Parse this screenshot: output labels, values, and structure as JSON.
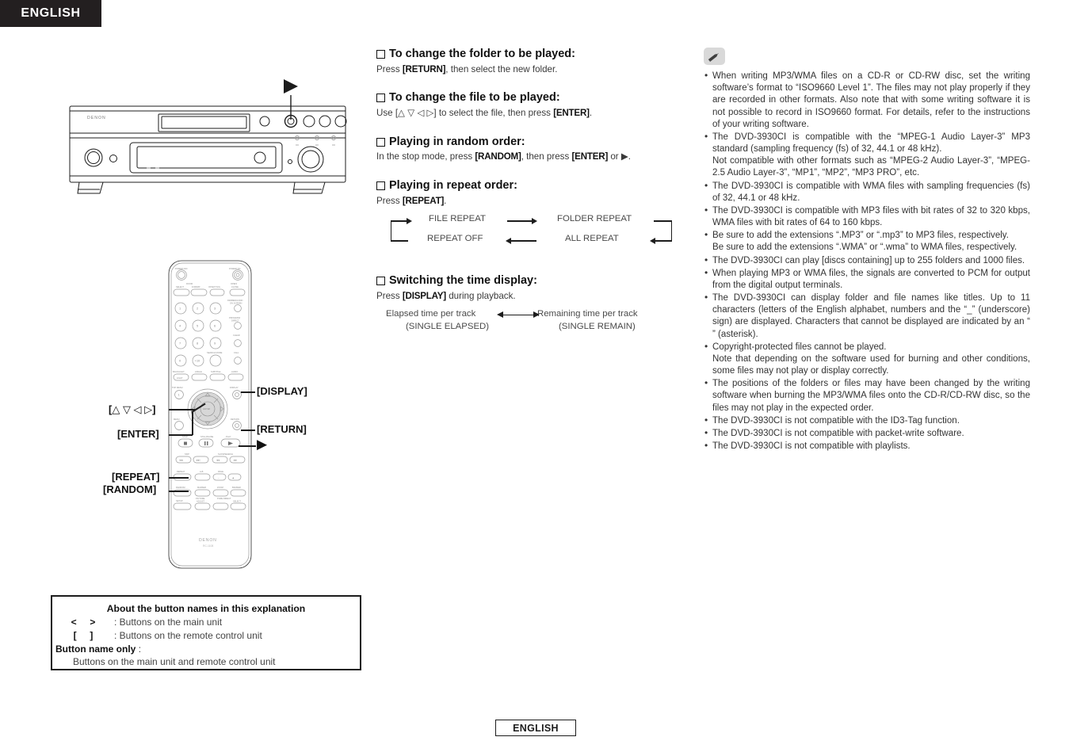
{
  "header": {
    "language_tab": "ENGLISH"
  },
  "footer": {
    "language_tab": "ENGLISH"
  },
  "device": {
    "model": "DVD-3930CI",
    "brand": "DENON",
    "remote_model": "RC-1108"
  },
  "middle_column": {
    "sections": [
      {
        "heading": "To change the folder to be played:",
        "body_pre": "Press ",
        "body_bold": "[RETURN]",
        "body_post": ", then select the new folder."
      },
      {
        "heading": "To change the file to be played:",
        "body_pre": "Use [△ ▽ ◁ ▷] to select the file, then press ",
        "body_bold": "[ENTER]",
        "body_post": "."
      },
      {
        "heading": "Playing in random order:",
        "body_pre": "In the stop mode, press ",
        "body_bold": "[RANDOM]",
        "body_mid": ", then press ",
        "body_bold2": "[ENTER]",
        "body_post": " or ▶."
      },
      {
        "heading": "Playing in repeat order:",
        "body_pre": "Press ",
        "body_bold": "[REPEAT]",
        "body_post": "."
      },
      {
        "heading": "Switching the time display:",
        "body_pre": "Press ",
        "body_bold": "[DISPLAY]",
        "body_post": " during playback."
      }
    ],
    "repeat_flow": {
      "file_repeat": "FILE REPEAT",
      "folder_repeat": "FOLDER REPEAT",
      "repeat_off": "REPEAT OFF",
      "all_repeat": "ALL REPEAT"
    },
    "time_flow": {
      "left_line1": "Elapsed time per track",
      "left_line2": "(SINGLE ELAPSED)",
      "right_line1": "Remaining time per track",
      "right_line2": "(SINGLE REMAIN)"
    }
  },
  "right_column": {
    "icon": "pencil-note-icon",
    "notes": [
      "When writing MP3/WMA files on a CD-R or CD-RW disc, set the writing software’s format to “ISO9660 Level 1”. The files may not play properly if they are recorded in other formats. Also note that with some writing software it is not possible to record in ISO9660 format. For details, refer to the instructions of your writing software.",
      "The DVD-3930CI is compatible with the “MPEG-1 Audio Layer-3” MP3 standard (sampling frequency (fs) of 32, 44.1 or 48 kHz).",
      "The DVD-3930CI is compatible with WMA files with sampling frequencies (fs) of 32, 44.1 or 48 kHz.",
      "The DVD-3930CI is compatible with MP3 files with bit rates of 32 to 320 kbps, WMA files with bit rates of 64 to 160 kbps.",
      "Be sure to add the extensions “.MP3” or “.mp3” to MP3 files, respectively.",
      "The DVD-3930CI can play [discs containing] up to 255 folders and 1000 files.",
      "When playing MP3 or WMA files, the signals are converted to PCM for output from the digital output terminals.",
      "The DVD-3930CI can display folder and file names like titles. Up to 11 characters (letters of the English alphabet, numbers and the “_” (underscore) sign) are displayed. Characters that cannot be displayed are indicated by an “  ” (asterisk).",
      "Copyright-protected files cannot be played.",
      "The positions of the folders or files may have been changed by the writing software when burning the MP3/WMA files onto the CD-R/CD-RW disc, so the files may not play in the expected order.",
      "The DVD-3930CI is not compatible with the ID3-Tag function.",
      "The DVD-3930CI is not compatible with packet-write software.",
      "The DVD-3930CI is not compatible with playlists."
    ],
    "note2_continuation": "Not compatible with other formats such as “MPEG-2 Audio Layer-3”, “MPEG-2.5 Audio Layer-3”, “MP1”, “MP2”, “MP3 PRO”, etc.",
    "note5_continuation": "Be sure to add the extensions “.WMA” or “.wma” to WMA files, respectively.",
    "note9_continuation": "Note that depending on the software used for burning and other conditions, some files may not play or display correctly."
  },
  "remote_callouts": {
    "cursor": "[△ ▽ ◁ ▷]",
    "enter": "[ENTER]",
    "repeat": "[REPEAT]",
    "random": "[RANDOM]",
    "display": "[DISPLAY]",
    "return": "[RETURN]",
    "play": "▶"
  },
  "legend_box": {
    "title": "About the button names in this explanation",
    "rows": [
      {
        "symbol_left": "<",
        "symbol_right": ">",
        "text": ": Buttons on the main unit"
      },
      {
        "symbol_left": "[",
        "symbol_right": "]",
        "text": ": Buttons on the remote control unit"
      }
    ],
    "strong_label": "Button name only",
    "strong_colon": ":",
    "last_line": "Buttons on the main unit and remote control unit"
  },
  "colors": {
    "ink": "#1c1c1c",
    "tab_bg": "#231f20",
    "body_text": "#3a3a3a",
    "icon_bg": "#d9d9d9"
  }
}
